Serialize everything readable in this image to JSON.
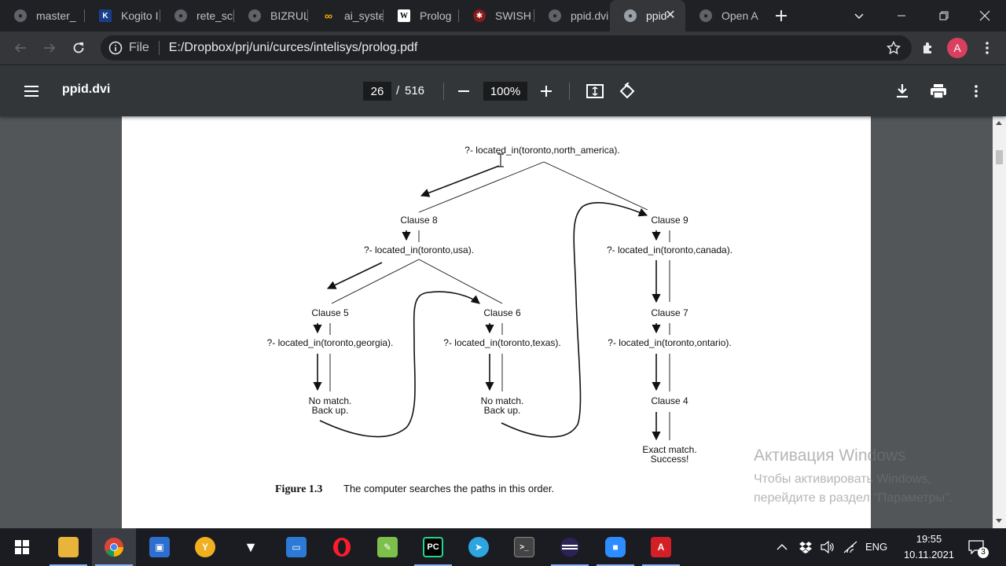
{
  "browser": {
    "tabs": [
      {
        "title": "master_",
        "icon": "github-icon"
      },
      {
        "title": "Kogito I",
        "icon": "kogito-icon"
      },
      {
        "title": "rete_sch",
        "icon": "github-icon"
      },
      {
        "title": "BIZRULE",
        "icon": "github-icon"
      },
      {
        "title": "ai_syste",
        "icon": "colab-icon"
      },
      {
        "title": "Prolog",
        "icon": "wikipedia-icon"
      },
      {
        "title": "SWISH",
        "icon": "swish-icon"
      },
      {
        "title": "ppid.dvi",
        "icon": "github-icon"
      },
      {
        "title": "ppid",
        "icon": "github-icon"
      },
      {
        "title": "Open A",
        "icon": "github-icon"
      }
    ],
    "url_scheme": "File",
    "url": "E:/Dropbox/prj/uni/curces/intelisys/prolog.pdf",
    "profile_initial": "A"
  },
  "pdf": {
    "title": "ppid.dvi",
    "current_page": "26",
    "page_separator": "/",
    "total_pages": "516",
    "zoom": "100%"
  },
  "diagram": {
    "root": "?-  located_in(toronto,north_america).",
    "clause8": "Clause  8",
    "q_usa": "?-  located_in(toronto,usa).",
    "clause9": "Clause  9",
    "q_canada": "?-  located_in(toronto,canada).",
    "clause5": "Clause  5",
    "q_georgia": "?-  located_in(toronto,georgia).",
    "clause6": "Clause  6",
    "q_texas": "?-  located_in(toronto,texas).",
    "clause7": "Clause  7",
    "q_ontario": "?-  located_in(toronto,ontario).",
    "nomatch1_a": "No  match.",
    "nomatch1_b": "Back  up.",
    "nomatch2_a": "No  match.",
    "nomatch2_b": "Back  up.",
    "clause4": "Clause  4",
    "success_a": "Exact  match.",
    "success_b": "Success!",
    "caption_label": "Figure 1.3",
    "caption_text": "The computer searches the paths in this order."
  },
  "watermark": {
    "line1": "Активация Windows",
    "line2": "Чтобы активировать Windows,",
    "line3": "перейдите в раздел \"Параметры\"."
  },
  "taskbar": {
    "apps": [
      "file-explorer-icon",
      "chrome-icon",
      "store-icon",
      "yandex-icon",
      "vixen-icon",
      "window-icon",
      "opera-icon",
      "notepad-icon",
      "pycharm-icon",
      "telegram-icon",
      "terminal-icon",
      "eclipse-icon",
      "zoom-icon",
      "acrobat-icon"
    ],
    "language": "ENG",
    "time": "19:55",
    "date": "10.11.2021",
    "notifications": "3"
  },
  "colors": {
    "tab_bg": "#202124",
    "active_tab_bg": "#35363a",
    "pdf_toolbar": "#323639",
    "pdf_backdrop": "#525659",
    "avatar": "#d93f5f"
  }
}
